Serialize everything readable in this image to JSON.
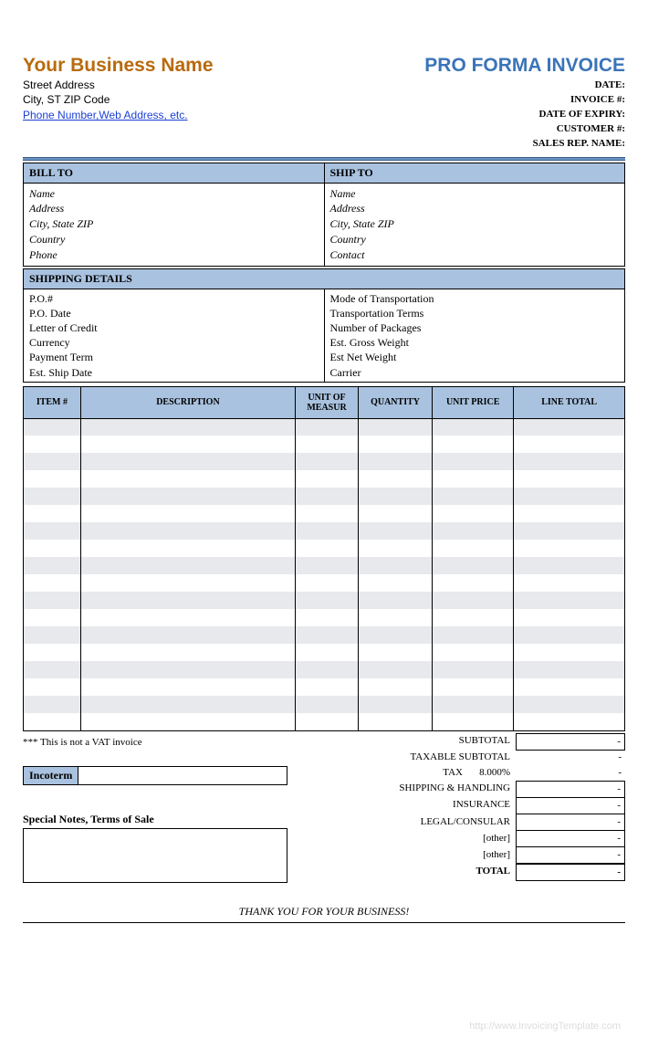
{
  "header": {
    "business_name": "Your Business Name",
    "street": "Street Address",
    "city_line": "City, ST  ZIP Code",
    "contact_link": "Phone Number,Web Address, etc.",
    "doc_title": "PRO FORMA INVOICE",
    "meta": {
      "date": "DATE:",
      "invoice_no": "INVOICE #:",
      "expiry": "DATE OF EXPIRY:",
      "customer_no": "CUSTOMER #:",
      "sales_rep": "SALES REP. NAME:"
    }
  },
  "bill_to": {
    "title": "BILL TO",
    "name": "Name",
    "address": "Address",
    "csz": "City, State ZIP",
    "country": "Country",
    "phone": "Phone"
  },
  "ship_to": {
    "title": "SHIP TO",
    "name": "Name",
    "address": "Address",
    "csz": "City, State ZIP",
    "country": "Country",
    "contact": "Contact"
  },
  "shipping": {
    "title": "SHIPPING DETAILS",
    "left": [
      "P.O.#",
      "P.O. Date",
      "Letter of Credit",
      "Currency",
      "Payment Term",
      "Est. Ship Date"
    ],
    "right": [
      "Mode of Transportation",
      "Transportation Terms",
      "Number of Packages",
      "Est. Gross Weight",
      "Est Net Weight",
      "Carrier"
    ]
  },
  "columns": {
    "item": "ITEM #",
    "desc": "DESCRIPTION",
    "uom": "UNIT OF MEASUR",
    "qty": "QUANTITY",
    "price": "UNIT PRICE",
    "total": "LINE TOTAL"
  },
  "vat_note": "*** This is not a VAT invoice",
  "incoterm_label": "Incoterm",
  "notes_label": "Special Notes, Terms of Sale",
  "totals": {
    "subtotal": {
      "label": "SUBTOTAL",
      "value": "-"
    },
    "taxable": {
      "label": "TAXABLE SUBTOTAL",
      "value": "-"
    },
    "tax": {
      "label": "TAX",
      "rate": "8.000%",
      "value": "-"
    },
    "shipping": {
      "label": "SHIPPING & HANDLING",
      "value": "-"
    },
    "insurance": {
      "label": "INSURANCE",
      "value": "-"
    },
    "legal": {
      "label": "LEGAL/CONSULAR",
      "value": "-"
    },
    "other1": {
      "label": "[other]",
      "value": "-"
    },
    "other2": {
      "label": "[other]",
      "value": "-"
    },
    "total": {
      "label": "TOTAL",
      "value": "-"
    }
  },
  "thank_you": "THANK YOU FOR YOUR BUSINESS!",
  "watermark": "http://www.InvoicingTemplate.com"
}
